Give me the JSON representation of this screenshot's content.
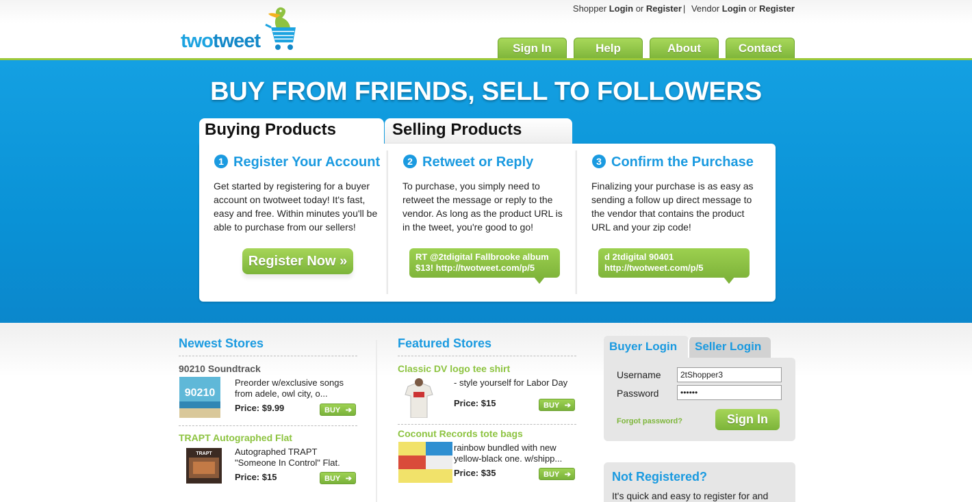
{
  "brand": {
    "two": "two",
    "tweet": "tweet"
  },
  "toplinks": {
    "shopper": "Shopper",
    "shopper_login": "Login",
    "or1": "or",
    "shopper_register": "Register",
    "sep": "|",
    "vendor": "Vendor",
    "vendor_login": "Login",
    "or2": "or",
    "vendor_register": "Register"
  },
  "nav": [
    "Sign In",
    "Help",
    "About",
    "Contact"
  ],
  "hero": {
    "title": "BUY FROM FRIENDS, SELL TO FOLLOWERS",
    "tabs": [
      "Buying Products",
      "Selling Products"
    ]
  },
  "steps": [
    {
      "num": "1",
      "title": "Register Your Account",
      "text": "Get started by registering for a buyer account on twotweet today! It's fast, easy and free. Within minutes you'll be able to purchase from our sellers!"
    },
    {
      "num": "2",
      "title": "Retweet or Reply",
      "text": "To purchase, you simply need to retweet the message or reply to the vendor. As long as the product URL is in the tweet, you're good to go!"
    },
    {
      "num": "3",
      "title": "Confirm the Purchase",
      "text": "Finalizing your purchase is as easy as sending a follow up direct message to the vendor that contains the product URL and your zip code!"
    }
  ],
  "register_button": "Register Now »",
  "bubbles": [
    {
      "line1": "RT @2tdigital Fallbrooke album",
      "line2": "$13! http://twotweet.com/p/5"
    },
    {
      "line1": "d 2tdigital 90401",
      "line2": "http://twotweet.com/p/5"
    }
  ],
  "newest": {
    "heading": "Newest Stores",
    "items": [
      {
        "title": "90210 Soundtrack",
        "desc": "Preorder w/exclusive songs from adele, owl city, o...",
        "price": "Price: $9.99",
        "buy": "BUY"
      },
      {
        "title": "TRAPT Autographed Flat",
        "desc": "Autographed TRAPT \"Someone In Control\" Flat.",
        "price": "Price: $15",
        "buy": "BUY"
      }
    ]
  },
  "featured": {
    "heading": "Featured Stores",
    "items": [
      {
        "title": "Classic DV logo tee shirt",
        "desc": "- style yourself for Labor Day",
        "price": "Price: $15",
        "buy": "BUY"
      },
      {
        "title": "Coconut Records tote bags",
        "desc": "rainbow bundled with new yellow-black one. w/shipp...",
        "price": "Price: $35",
        "buy": "BUY"
      }
    ]
  },
  "login": {
    "tabs": [
      "Buyer Login",
      "Seller Login"
    ],
    "username_label": "Username",
    "password_label": "Password",
    "username_value": "2tShopper3",
    "password_value": "••••••",
    "forgot": "Forgot password?",
    "submit": "Sign In"
  },
  "notreg": {
    "heading": "Not Registered?",
    "text": "It's quick and easy to register for and"
  },
  "colors": {
    "blue": "#1a9ae0",
    "green": "#7fb63b",
    "hero": "#0a92d6"
  },
  "icons": {
    "logo": "pelican-cart-logo",
    "buy_arrow": "arrow-right-icon"
  }
}
